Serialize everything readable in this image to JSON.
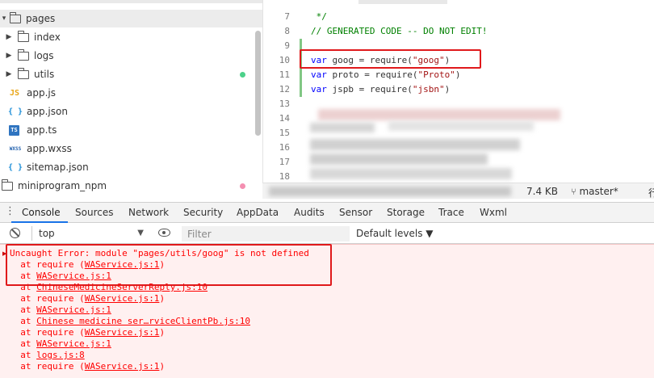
{
  "tree": {
    "items": [
      {
        "label": "pages",
        "kind": "folder",
        "expanded": true
      },
      {
        "label": "index",
        "kind": "folder",
        "expanded": false
      },
      {
        "label": "logs",
        "kind": "folder",
        "expanded": false
      },
      {
        "label": "utils",
        "kind": "folder",
        "expanded": false,
        "status_color": "#4cd18a"
      },
      {
        "label": "app.js",
        "kind": "file",
        "icon": "js-icon",
        "icon_text": "JS"
      },
      {
        "label": "app.json",
        "kind": "file",
        "icon": "json-icon",
        "icon_text": "{ }"
      },
      {
        "label": "app.ts",
        "kind": "file",
        "icon": "ts-icon",
        "icon_text": "TS"
      },
      {
        "label": "app.wxss",
        "kind": "file",
        "icon": "wxss-icon",
        "icon_text": "WXSS"
      },
      {
        "label": "sitemap.json",
        "kind": "file",
        "icon": "json-icon",
        "icon_text": "{ }"
      },
      {
        "label": "miniprogram_npm",
        "kind": "folder",
        "expanded": false,
        "status_color": "#f48fb1"
      }
    ]
  },
  "editor": {
    "lines": [
      {
        "num": "7",
        "text": " */"
      },
      {
        "num": "8",
        "text": "// GENERATED CODE -- DO NOT EDIT!"
      },
      {
        "num": "9",
        "text": ""
      },
      {
        "num": "10",
        "kw": "var",
        "name": " goog = require(",
        "str": "\"goog\"",
        "end": ")"
      },
      {
        "num": "11",
        "kw": "var",
        "name": " proto = require(",
        "str": "\"Proto\"",
        "end": ")"
      },
      {
        "num": "12",
        "kw": "var",
        "name": " jspb = require(",
        "str": "\"jsbn\"",
        "end": ")"
      },
      {
        "num": "13",
        "text": ""
      },
      {
        "num": "14",
        "text": ""
      },
      {
        "num": "15",
        "text": ""
      },
      {
        "num": "16",
        "text": ""
      },
      {
        "num": "17",
        "text": ""
      },
      {
        "num": "18",
        "text": ""
      }
    ]
  },
  "statusbar": {
    "size": "7.4 KB",
    "branch": "master*",
    "right_glyph": "行"
  },
  "devtools": {
    "tabs": [
      "Console",
      "Sources",
      "Network",
      "Security",
      "AppData",
      "Audits",
      "Sensor",
      "Storage",
      "Trace",
      "Wxml"
    ],
    "active_tab": "Console"
  },
  "console_toolbar": {
    "context": "top",
    "filter_placeholder": "Filter",
    "levels": "Default levels ▼"
  },
  "console": {
    "error_color": "#ff0000",
    "lines": [
      {
        "text": "Uncaught Error: module \"pages/utils/goog\" is not defined"
      },
      {
        "pre": "  at require (",
        "link": "WAService.js:1",
        "post": ")"
      },
      {
        "pre": "  at ",
        "link": "WAService.js:1",
        "post": ""
      },
      {
        "pre": "  at ",
        "link": "ChineseMedicineServerReply.js:10",
        "post": ""
      },
      {
        "pre": "  at require (",
        "link": "WAService.js:1",
        "post": ")"
      },
      {
        "pre": "  at ",
        "link": "WAService.js:1",
        "post": ""
      },
      {
        "pre": "  at ",
        "link": "Chinese medicine ser…rviceClientPb.js:10",
        "post": ""
      },
      {
        "pre": "  at require (",
        "link": "WAService.js:1",
        "post": ")"
      },
      {
        "pre": "  at ",
        "link": "WAService.js:1",
        "post": ""
      },
      {
        "pre": "  at ",
        "link": "logs.js:8",
        "post": ""
      },
      {
        "pre": "  at require (",
        "link": "WAService.js:1",
        "post": ")"
      }
    ]
  }
}
